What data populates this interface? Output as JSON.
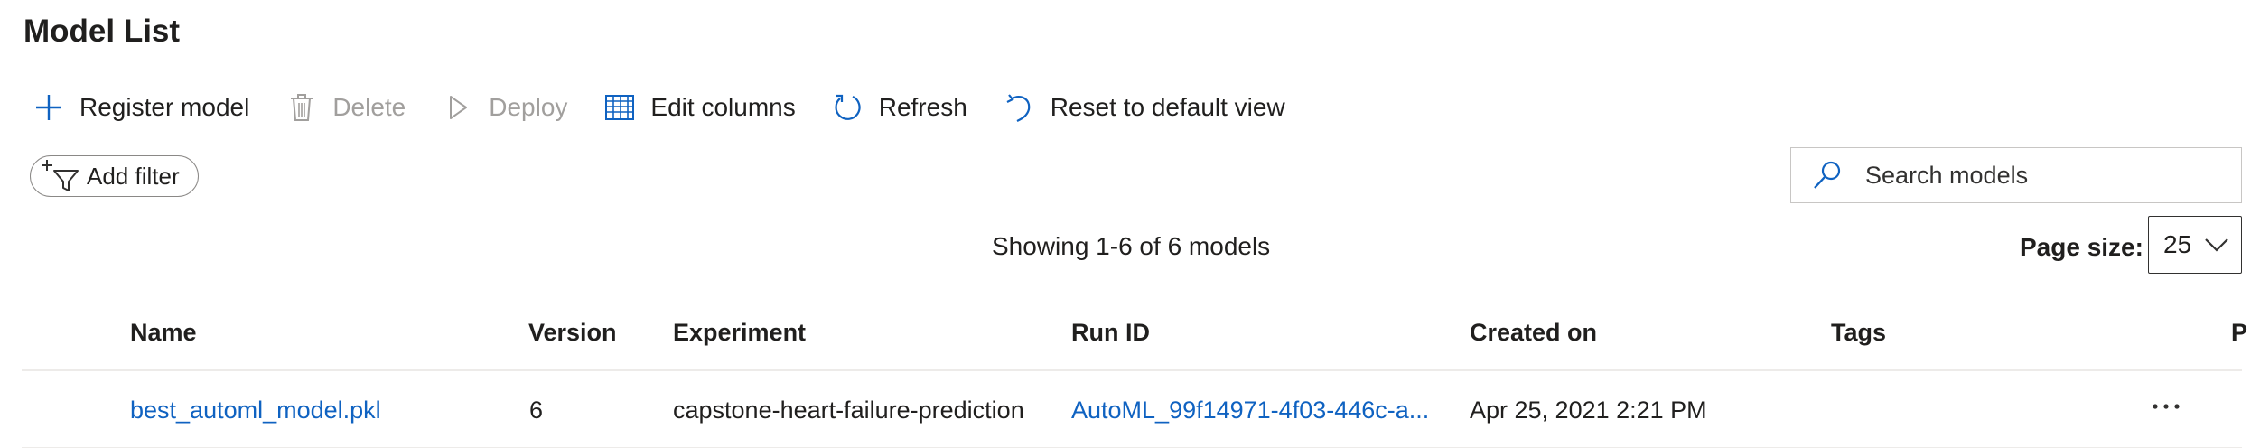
{
  "page": {
    "title": "Model List"
  },
  "toolbar": {
    "register_label": "Register model",
    "delete_label": "Delete",
    "deploy_label": "Deploy",
    "edit_columns_label": "Edit columns",
    "refresh_label": "Refresh",
    "reset_label": "Reset to default view"
  },
  "filter": {
    "add_filter_label": "Add filter"
  },
  "search": {
    "placeholder": "Search models",
    "value": ""
  },
  "summary": {
    "showing_text": "Showing 1-6 of 6 models"
  },
  "pagination": {
    "page_size_label": "Page size:",
    "page_size_value": "25"
  },
  "table": {
    "columns": [
      "Name",
      "Version",
      "Experiment",
      "Run ID",
      "Created on",
      "Tags",
      "P"
    ],
    "rows": [
      {
        "name": "best_automl_model.pkl",
        "version": "6",
        "experiment": "capstone-heart-failure-prediction",
        "run_id": "AutoML_99f14971-4f03-446c-a...",
        "created_on": "Apr 25, 2021 2:21 PM",
        "tags": ""
      }
    ]
  },
  "colors": {
    "accent": "#0f62c1",
    "disabled": "#a19f9d",
    "text": "#201f1e",
    "divider": "#edebe9"
  },
  "icons": {
    "register": "plus-icon",
    "delete": "trash-icon",
    "deploy": "play-icon",
    "edit_columns": "table-columns-icon",
    "refresh": "refresh-icon",
    "reset": "undo-icon",
    "add_filter": "filter-add-icon",
    "search": "search-icon",
    "page_size": "chevron-down-icon",
    "row_actions": "more-icon"
  }
}
